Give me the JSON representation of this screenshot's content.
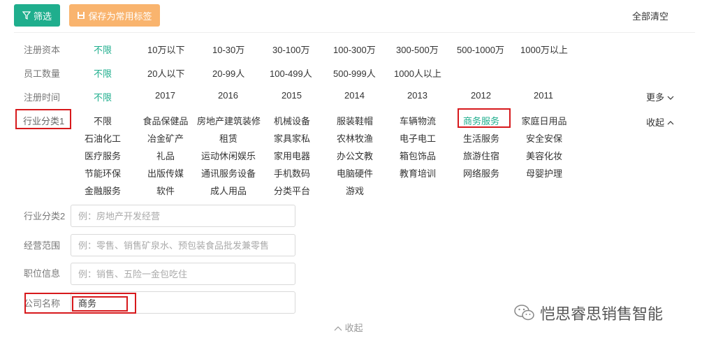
{
  "toolbar": {
    "filter_label": "筛选",
    "save_label": "保存为常用标签",
    "clear_all": "全部清空"
  },
  "capital": {
    "label": "注册资本",
    "options": [
      "不限",
      "10万以下",
      "10-30万",
      "30-100万",
      "100-300万",
      "300-500万",
      "500-1000万",
      "1000万以上"
    ]
  },
  "staff": {
    "label": "员工数量",
    "options": [
      "不限",
      "20人以下",
      "20-99人",
      "100-499人",
      "500-999人",
      "1000人以上"
    ]
  },
  "reg_time": {
    "label": "注册时间",
    "options": [
      "不限",
      "2017",
      "2016",
      "2015",
      "2014",
      "2013",
      "2012",
      "2011"
    ],
    "more": "更多"
  },
  "industry1": {
    "label": "行业分类1",
    "collapse": "收起",
    "selected": "商务服务",
    "rows": [
      [
        "不限",
        "食品保健品",
        "房地产建筑装修",
        "机械设备",
        "服装鞋帽",
        "车辆物流",
        "商务服务",
        "家庭日用品"
      ],
      [
        "石油化工",
        "冶金矿产",
        "租赁",
        "家具家私",
        "农林牧渔",
        "电子电工",
        "生活服务",
        "安全安保"
      ],
      [
        "医疗服务",
        "礼品",
        "运动休闲娱乐",
        "家用电器",
        "办公文教",
        "箱包饰品",
        "旅游住宿",
        "美容化妆"
      ],
      [
        "节能环保",
        "出版传媒",
        "通讯服务设备",
        "手机数码",
        "电脑硬件",
        "教育培训",
        "网络服务",
        "母婴护理"
      ],
      [
        "金融服务",
        "软件",
        "成人用品",
        "分类平台",
        "游戏"
      ]
    ]
  },
  "industry2": {
    "label": "行业分类2",
    "placeholder": "例：房地产开发经营",
    "value": ""
  },
  "scope": {
    "label": "经营范围",
    "placeholder": "例：零售、销售矿泉水、预包装食品批发兼零售",
    "value": ""
  },
  "position": {
    "label": "职位信息",
    "placeholder": "例：销售、五险一金包吃住",
    "value": ""
  },
  "company": {
    "label": "公司名称",
    "value": "商务",
    "placeholder": ""
  },
  "bottom_collapse": "收起",
  "watermark": "恺思睿思销售智能",
  "colors": {
    "accent": "#1fae8d",
    "save": "#f9b46e",
    "highlight": "#d7191c"
  }
}
